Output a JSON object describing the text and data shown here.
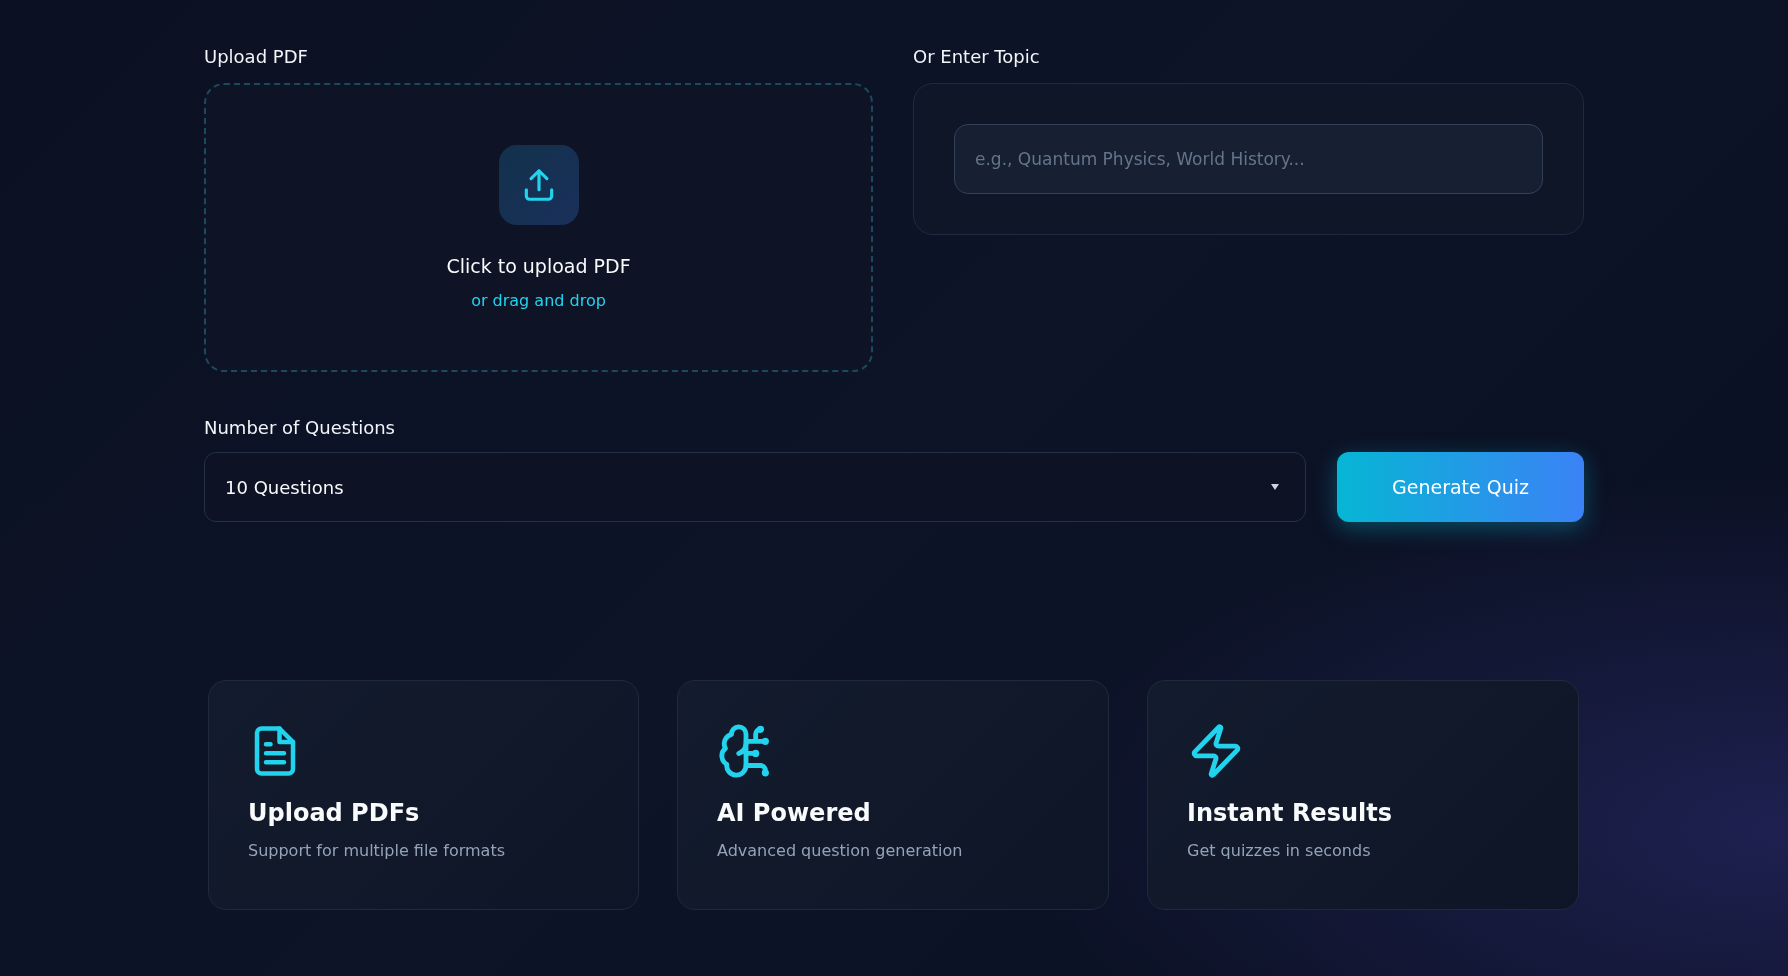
{
  "upload": {
    "label": "Upload PDF",
    "title": "Click to upload PDF",
    "subtitle": "or drag and drop"
  },
  "topic": {
    "label": "Or Enter Topic",
    "placeholder": "e.g., Quantum Physics, World History..."
  },
  "questions": {
    "label": "Number of Questions",
    "value": "10 Questions"
  },
  "generate_button": "Generate Quiz",
  "features": [
    {
      "kind": "document",
      "title": "Upload PDFs",
      "description": "Support for multiple file formats"
    },
    {
      "kind": "brain",
      "title": "AI Powered",
      "description": "Advanced question generation"
    },
    {
      "kind": "bolt",
      "title": "Instant Results",
      "description": "Get quizzes in seconds"
    }
  ]
}
